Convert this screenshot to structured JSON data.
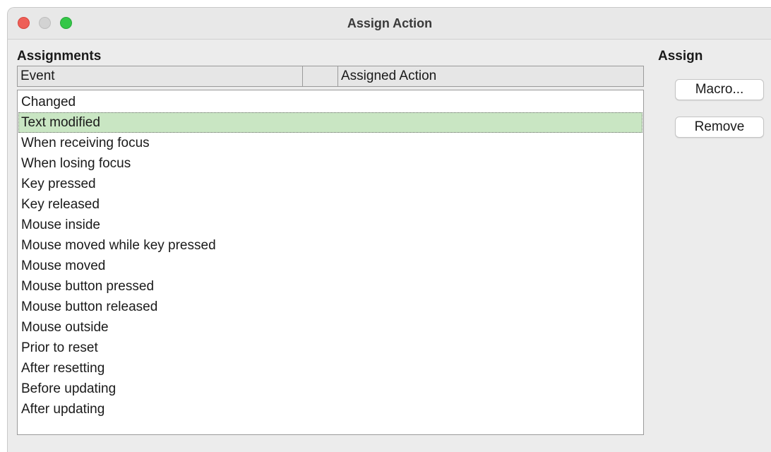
{
  "window": {
    "title": "Assign Action"
  },
  "assignments": {
    "label": "Assignments",
    "columns": [
      "Event",
      "",
      "Assigned Action"
    ],
    "selected_index": 1,
    "events": [
      "Changed",
      "Text modified",
      "When receiving focus",
      "When losing focus",
      "Key pressed",
      "Key released",
      "Mouse inside",
      "Mouse moved while key pressed",
      "Mouse moved",
      "Mouse button pressed",
      "Mouse button released",
      "Mouse outside",
      "Prior to reset",
      "After resetting",
      "Before updating",
      "After updating"
    ]
  },
  "assign": {
    "label": "Assign",
    "macro_button": "Macro...",
    "remove_button": "Remove"
  },
  "colors": {
    "selection": "#c9e6c3",
    "close": "#ee5f57",
    "minimize": "#d3d3d3",
    "maximize": "#34c748"
  }
}
